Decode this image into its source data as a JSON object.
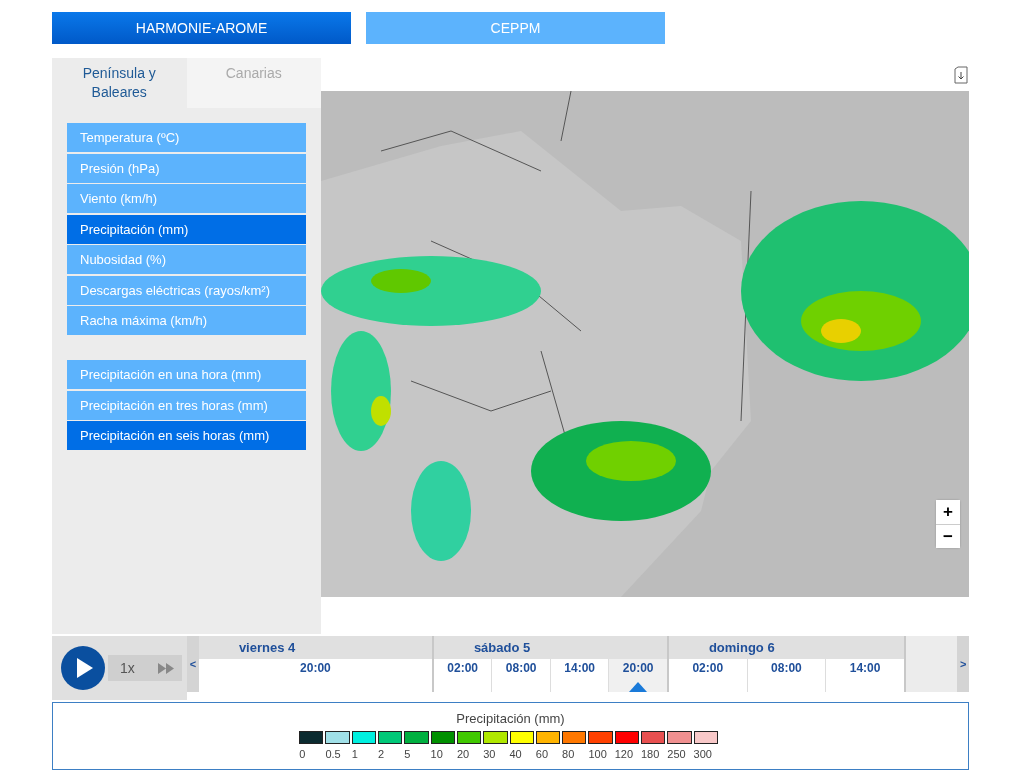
{
  "models": [
    {
      "label": "HARMONIE-AROME",
      "selected": true
    },
    {
      "label": "CEPPM",
      "selected": false
    }
  ],
  "region_tabs": [
    {
      "label": "Península y Baleares",
      "selected": true
    },
    {
      "label": "Canarias",
      "selected": false
    }
  ],
  "menu_groups": [
    {
      "items": [
        {
          "label": "Temperatura (ºC)",
          "selected": false
        },
        {
          "label": "Presión (hPa)",
          "selected": false
        },
        {
          "label": "Viento (km/h)",
          "selected": false
        },
        {
          "label": "Precipitación (mm)",
          "selected": true
        },
        {
          "label": "Nubosidad (%)",
          "selected": false
        },
        {
          "label": "Descargas eléctricas (rayos/km²)",
          "selected": false
        },
        {
          "label": "Racha máxima (km/h)",
          "selected": false
        }
      ]
    },
    {
      "items": [
        {
          "label": "Precipitación en una hora (mm)",
          "selected": false
        },
        {
          "label": "Precipitación en tres horas (mm)",
          "selected": false
        },
        {
          "label": "Precipitación en seis horas (mm)",
          "selected": true
        }
      ]
    }
  ],
  "map": {
    "zoom_in": "+",
    "zoom_out": "−"
  },
  "player": {
    "speed": "1x",
    "prev": "<",
    "next": ">"
  },
  "days": [
    {
      "label": "viernes 4",
      "times": [
        {
          "label": "20:00",
          "selected": false
        }
      ]
    },
    {
      "label": "sábado 5",
      "times": [
        {
          "label": "02:00",
          "selected": false
        },
        {
          "label": "08:00",
          "selected": false
        },
        {
          "label": "14:00",
          "selected": false
        },
        {
          "label": "20:00",
          "selected": true
        }
      ]
    },
    {
      "label": "domingo 6",
      "times": [
        {
          "label": "02:00",
          "selected": false
        },
        {
          "label": "08:00",
          "selected": false
        },
        {
          "label": "14:00",
          "selected": false
        }
      ]
    }
  ],
  "legend": {
    "title": "Precipitación (mm)",
    "items": [
      {
        "color": "#0b2b30",
        "label": "0"
      },
      {
        "color": "#a0e0e8",
        "label": "0.5"
      },
      {
        "color": "#00f0e0",
        "label": "1"
      },
      {
        "color": "#00c878",
        "label": "2"
      },
      {
        "color": "#00b040",
        "label": "5"
      },
      {
        "color": "#009000",
        "label": "10"
      },
      {
        "color": "#40c800",
        "label": "20"
      },
      {
        "color": "#b0e800",
        "label": "30"
      },
      {
        "color": "#ffff00",
        "label": "40"
      },
      {
        "color": "#ffb400",
        "label": "60"
      },
      {
        "color": "#ff7800",
        "label": "80"
      },
      {
        "color": "#ff4000",
        "label": "100"
      },
      {
        "color": "#ff0000",
        "label": "120"
      },
      {
        "color": "#e85050",
        "label": "180"
      },
      {
        "color": "#f09090",
        "label": "250"
      },
      {
        "color": "#f8c8c8",
        "label": "300"
      }
    ]
  }
}
